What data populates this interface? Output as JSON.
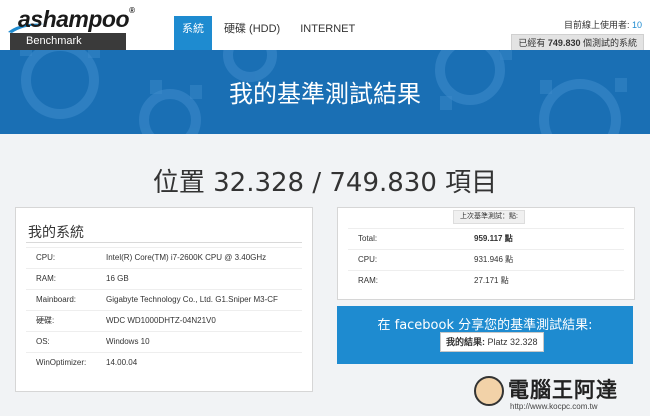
{
  "header": {
    "logo_text": "ashampoo",
    "logo_mark": "®",
    "product": "Benchmark",
    "nav": [
      {
        "label": "系統",
        "active": true
      },
      {
        "label": "硬碟 (HDD)",
        "active": false
      },
      {
        "label": "INTERNET",
        "active": false
      }
    ],
    "users_label": "目前線上使用者:",
    "users_count": "10",
    "tests_prefix": "已經有",
    "tests_count": "749.830",
    "tests_suffix": "個測試的系統"
  },
  "banner": {
    "title": "我的基準測試結果"
  },
  "position_text": "位置 32.328 / 749.830 項目",
  "system": {
    "title": "我的系統",
    "rows": [
      {
        "key": "CPU:",
        "value": "Intel(R) Core(TM) i7-2600K CPU @ 3.40GHz"
      },
      {
        "key": "RAM:",
        "value": "16 GB"
      },
      {
        "key": "Mainboard:",
        "value": "Gigabyte Technology Co., Ltd. G1.Sniper M3-CF"
      },
      {
        "key": "硬碟:",
        "value": "WDC WD1000DHTZ-04N21V0"
      },
      {
        "key": "OS:",
        "value": "Windows 10"
      },
      {
        "key": "WinOptimizer:",
        "value": "14.00.04"
      }
    ]
  },
  "scores": {
    "header": "上次基準測試：點:",
    "rows": [
      {
        "key": "Total:",
        "value": "959.117 點"
      },
      {
        "key": "CPU:",
        "value": "931.946 點"
      },
      {
        "key": "RAM:",
        "value": "27.171 點"
      }
    ]
  },
  "facebook": {
    "text": "在 facebook 分享您的基準測試結果:",
    "button_bold": "我的結果:",
    "button_value": "Platz 32.328"
  },
  "watermark": {
    "title": "電腦王阿達",
    "url": "http://www.kocpc.com.tw"
  },
  "colors": {
    "accent": "#1e8bd0",
    "banner": "#1a6fb4",
    "dark_bar": "#3a3a3a"
  }
}
